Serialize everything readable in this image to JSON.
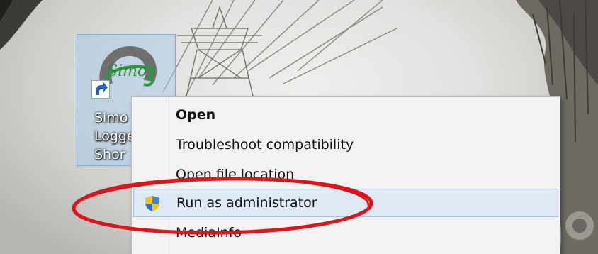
{
  "desktop": {
    "icon": {
      "label_lines": [
        "Simo",
        "Logge",
        "Shor"
      ],
      "art_text": "Simo"
    }
  },
  "context_menu": {
    "items": [
      {
        "label": "Open",
        "bold": true
      },
      {
        "label": "Troubleshoot compatibility"
      },
      {
        "label": "Open file location"
      },
      {
        "label": "Run as administrator",
        "icon": "uac-shield-icon",
        "highlighted": true
      },
      {
        "label": "MediaInfo"
      }
    ]
  },
  "annotation": {
    "color": "#d8161c"
  }
}
